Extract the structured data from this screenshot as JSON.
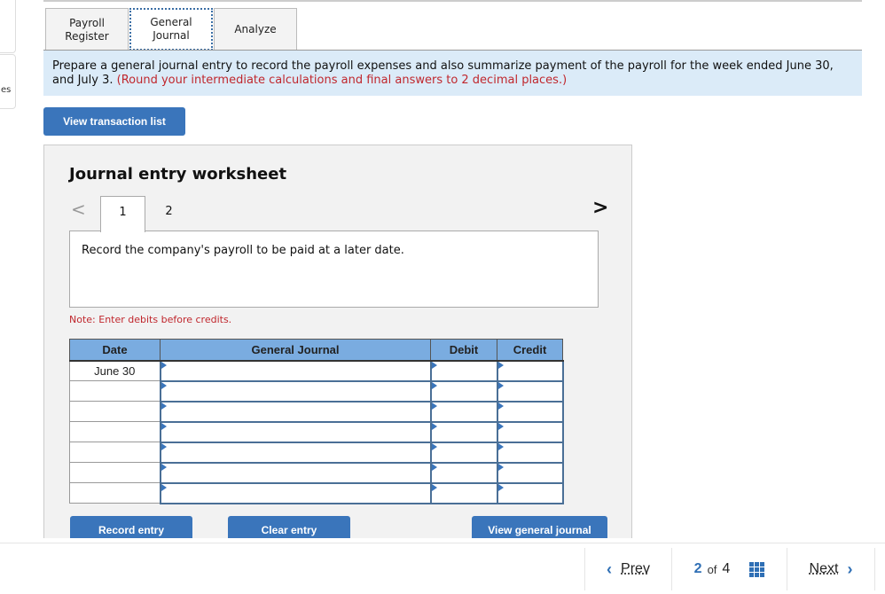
{
  "sidebar_stub": {
    "partial_text": "es"
  },
  "tabs": [
    {
      "label": "Payroll\nRegister",
      "line1": "Payroll",
      "line2": "Register",
      "active": false
    },
    {
      "label": "General\nJournal",
      "line1": "General",
      "line2": "Journal",
      "active": true
    },
    {
      "label": "Analyze",
      "line1": "Analyze",
      "line2": "",
      "active": false
    }
  ],
  "instructions": {
    "text": "Prepare a general journal entry to record the payroll expenses and also summarize payment of the payroll for the week ended June 30, and July 3.",
    "note": "(Round your intermediate calculations and final answers to 2 decimal places.)"
  },
  "buttons": {
    "view_transaction_list": "View transaction list",
    "record_entry": "Record entry",
    "clear_entry": "Clear entry",
    "view_general_journal": "View general journal"
  },
  "worksheet": {
    "title": "Journal entry worksheet",
    "prev_icon": "<",
    "next_icon": ">",
    "entry_tabs": [
      "1",
      "2"
    ],
    "active_entry": "1",
    "description": "Record the company's payroll to be paid at a later date.",
    "note": "Note: Enter debits before credits.",
    "table": {
      "headers": {
        "date": "Date",
        "general_journal": "General Journal",
        "debit": "Debit",
        "credit": "Credit"
      },
      "rows": [
        {
          "date": "June 30",
          "account": "",
          "debit": "",
          "credit": ""
        },
        {
          "date": "",
          "account": "",
          "debit": "",
          "credit": ""
        },
        {
          "date": "",
          "account": "",
          "debit": "",
          "credit": ""
        },
        {
          "date": "",
          "account": "",
          "debit": "",
          "credit": ""
        },
        {
          "date": "",
          "account": "",
          "debit": "",
          "credit": ""
        },
        {
          "date": "",
          "account": "",
          "debit": "",
          "credit": ""
        },
        {
          "date": "",
          "account": "",
          "debit": "",
          "credit": ""
        }
      ]
    }
  },
  "pager": {
    "prev_label": "Prev",
    "next_label": "Next",
    "current": "2",
    "of_label": "of",
    "total": "4",
    "prev_icon": "‹",
    "next_icon": "›",
    "grid_icon": "grid-icon"
  },
  "colors": {
    "accent": "#3a75bb",
    "header_blue": "#7aace0",
    "instruction_bg": "#dbebf8",
    "warning_red": "#c0272d"
  }
}
